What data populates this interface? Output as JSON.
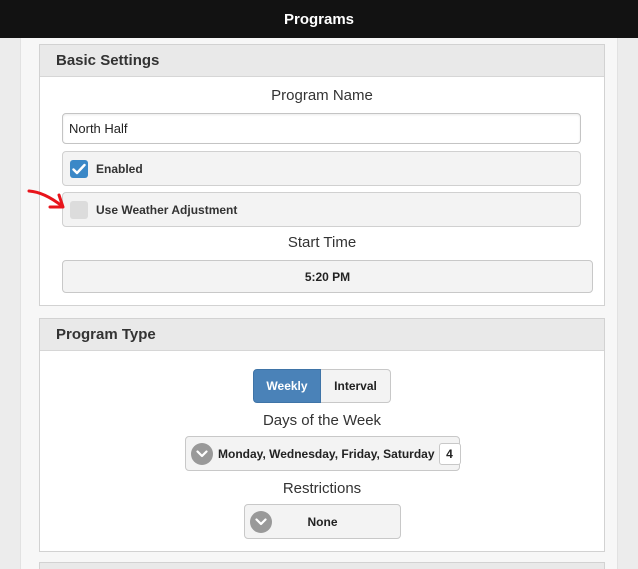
{
  "header": {
    "title": "Programs"
  },
  "basic_settings": {
    "title": "Basic Settings",
    "program_name_label": "Program Name",
    "program_name_value": "North Half",
    "enabled": {
      "label": "Enabled",
      "checked": true
    },
    "weather_adjustment": {
      "label": "Use Weather Adjustment",
      "checked": false
    },
    "start_time_label": "Start Time",
    "start_time_value": "5:20 PM"
  },
  "program_type": {
    "title": "Program Type",
    "options": [
      "Weekly",
      "Interval"
    ],
    "selected": "Weekly",
    "days_label": "Days of the Week",
    "days_value": "Monday, Wednesday, Friday, Saturday",
    "days_count": "4",
    "restrictions_label": "Restrictions",
    "restrictions_value": "None"
  },
  "colors": {
    "header_bg": "#121212",
    "accent": "#4a82b8",
    "checkbox_on": "#3b88c7",
    "annotation_arrow": "#e8141b"
  },
  "icons": [
    "checkmark-icon",
    "chevron-down-icon",
    "red-arrow-annotation"
  ]
}
